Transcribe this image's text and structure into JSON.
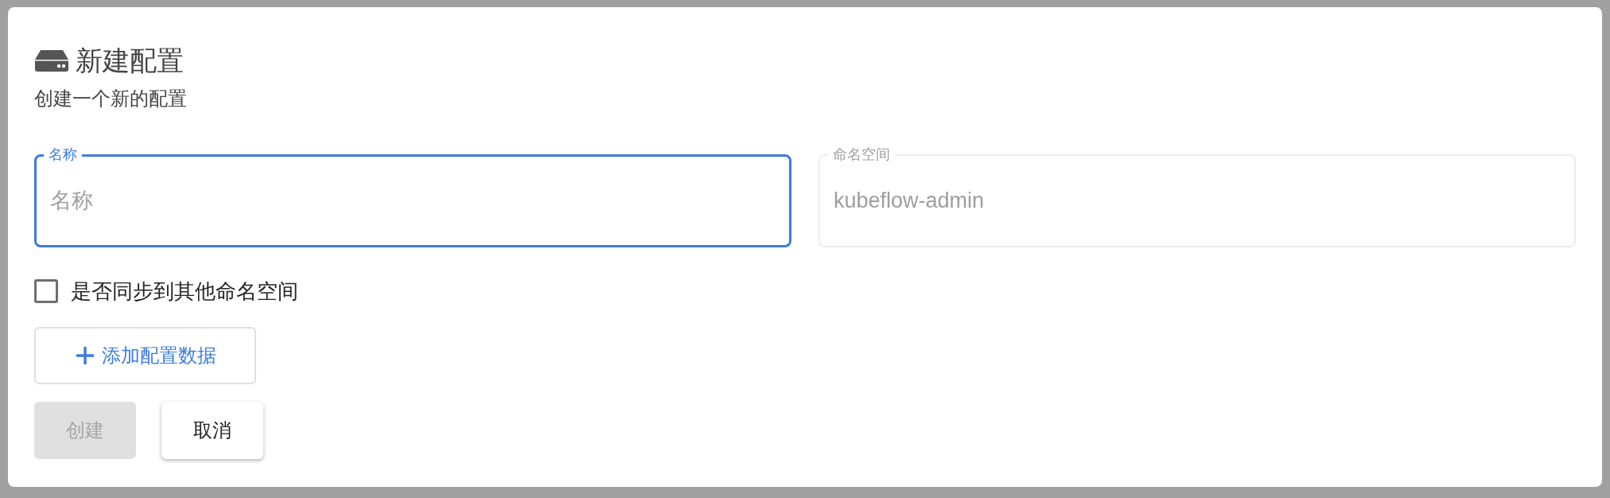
{
  "dialog": {
    "title": "新建配置",
    "subtitle": "创建一个新的配置"
  },
  "fields": [
    {
      "label": "名称",
      "placeholder": "名称",
      "focused": true,
      "disabled": false
    },
    {
      "label": "命名空间",
      "value": "kubeflow-admin",
      "focused": false,
      "disabled": true
    }
  ],
  "sync_checkbox": {
    "label": "是否同步到其他命名空间",
    "checked": false
  },
  "add_button": {
    "label": "添加配置数据"
  },
  "actions": [
    {
      "label": "创建",
      "disabled": true
    },
    {
      "label": "取消",
      "disabled": false
    }
  ]
}
